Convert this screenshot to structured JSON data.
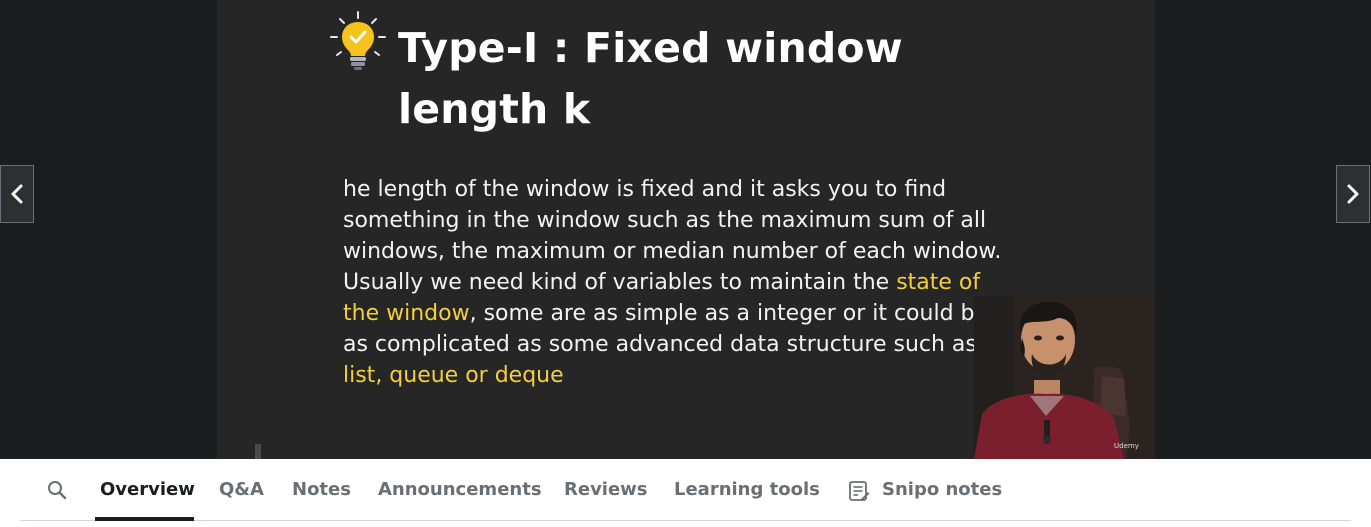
{
  "slide": {
    "title_line1": "Type-I : Fixed window",
    "title_line2": "length k",
    "body_seg1": "he length of the window is fixed and it asks you to find something in the window such as the maximum sum of all windows, the maximum or median number of each window. Usually we need kind of variables to maintain the ",
    "body_hl1": "state of the window",
    "body_seg2": ", some are as simple as a integer or it could be as complicated as some advanced data structure such as ",
    "body_hl2": "list, queue or deque"
  },
  "presenter": {
    "watermark": "Udemy"
  },
  "tabs": {
    "overview": "Overview",
    "qa": "Q&A",
    "notes": "Notes",
    "announcements": "Announcements",
    "reviews": "Reviews",
    "learning_tools": "Learning tools",
    "snipo_notes": "Snipo notes"
  },
  "colors": {
    "highlight": "#f3cf3d",
    "slide_bg": "#262626",
    "player_bg": "#1c1d1f",
    "active_tab": "#1c1d1f",
    "inactive_tab": "#6a6f73"
  },
  "icons": {
    "bulb": "lightbulb-icon",
    "prev": "chevron-left-icon",
    "next": "chevron-right-icon",
    "search": "search-icon",
    "snipo": "notes-list-icon"
  }
}
